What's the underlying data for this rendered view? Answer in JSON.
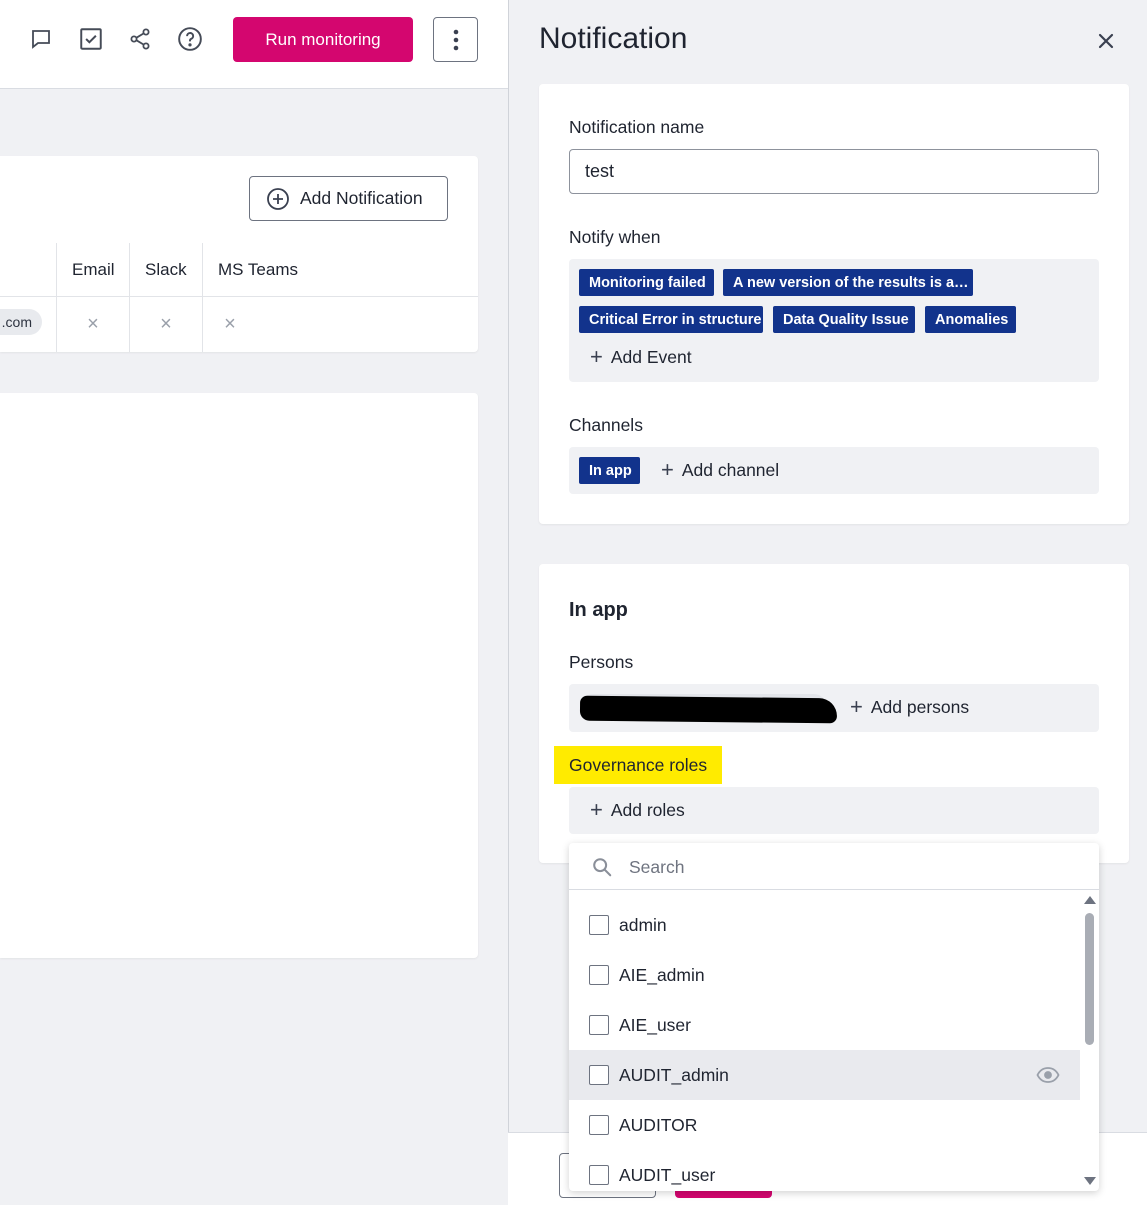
{
  "toolbar": {
    "icons": [
      "comment-icon",
      "checklist-icon",
      "share-icon",
      "help-icon"
    ],
    "run_label": "Run monitoring",
    "more_icon": "kebab-icon"
  },
  "notifications_card": {
    "add_label": "Add Notification",
    "columns": [
      "Email",
      "Slack",
      "MS Teams"
    ],
    "row": {
      "email_fragment": ".com",
      "email": "×",
      "slack": "×",
      "teams": "×"
    }
  },
  "link_fragment": "t",
  "drawer": {
    "title": "Notification",
    "close_icon": "close-icon",
    "name_label": "Notification name",
    "name_value": "test",
    "notify_when_label": "Notify when",
    "events": [
      "Monitoring failed",
      "A new version of the results is a…",
      "Critical Error in structure",
      "Data Quality Issue",
      "Anomalies"
    ],
    "add_event_label": "Add Event",
    "channels_label": "Channels",
    "channels": [
      "In app"
    ],
    "add_channel_label": "Add channel",
    "in_app_title": "In app",
    "persons_label": "Persons",
    "add_persons_label": "Add persons",
    "governance_label": "Governance roles",
    "add_roles_label": "Add roles"
  },
  "dropdown": {
    "search_placeholder": "Search",
    "items": [
      "admin",
      "AIE_admin",
      "AIE_user",
      "AUDIT_admin",
      "AUDITOR",
      "AUDIT_user"
    ],
    "hovered_item": "AUDIT_admin"
  },
  "colors": {
    "primary": "#d4066f",
    "tag": "#12338c",
    "highlight": "#ffeb00"
  }
}
